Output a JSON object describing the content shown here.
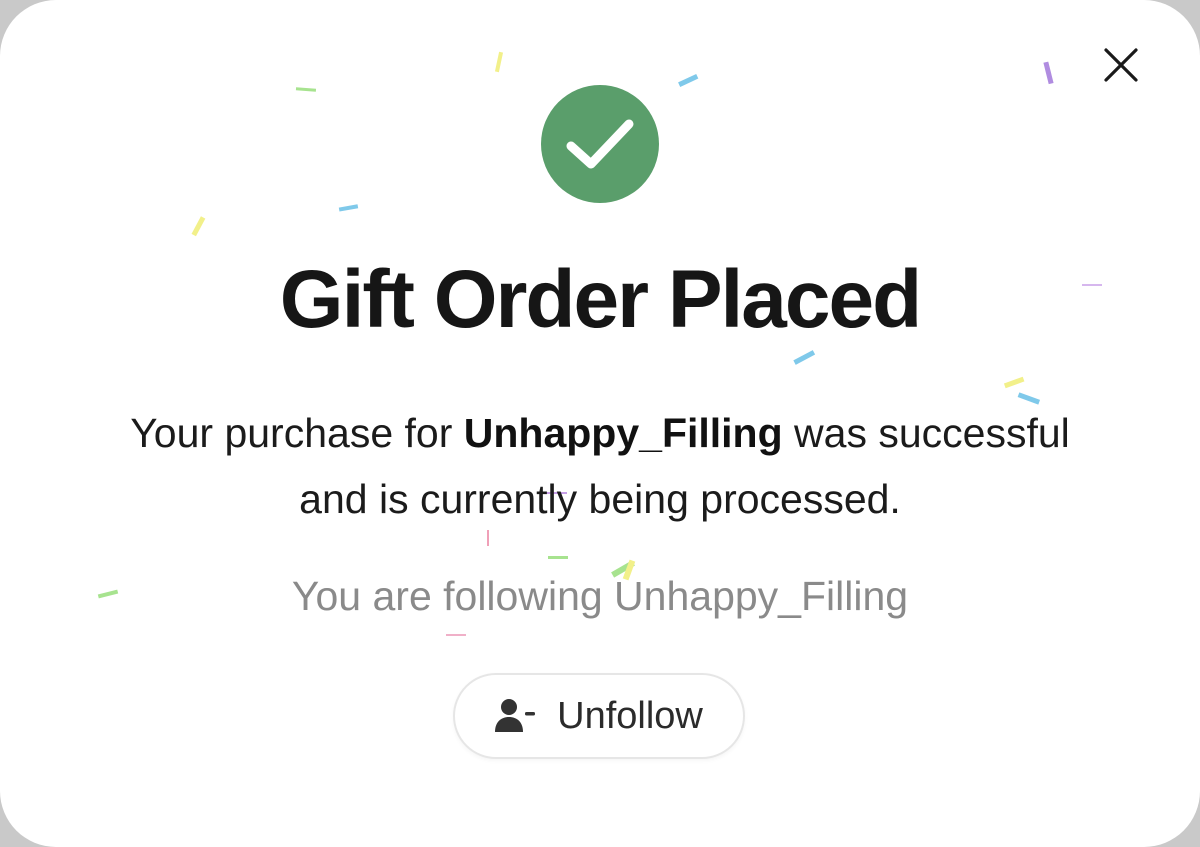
{
  "dialog": {
    "title": "Gift Order Placed",
    "message_prefix": "Your purchase for ",
    "recipient": "Unhappy_Filling",
    "message_suffix": " was successful and is currently being processed.",
    "following_text": "You are following Unhappy_Filling",
    "unfollow_label": "Unfollow",
    "close_icon": "close-icon",
    "status_icon": "checkmark-icon",
    "button_icon": "user-minus-icon"
  },
  "colors": {
    "success": "#5a9e6b",
    "title": "#161616",
    "body": "#1b1b1b",
    "muted": "#8a8a8a"
  }
}
